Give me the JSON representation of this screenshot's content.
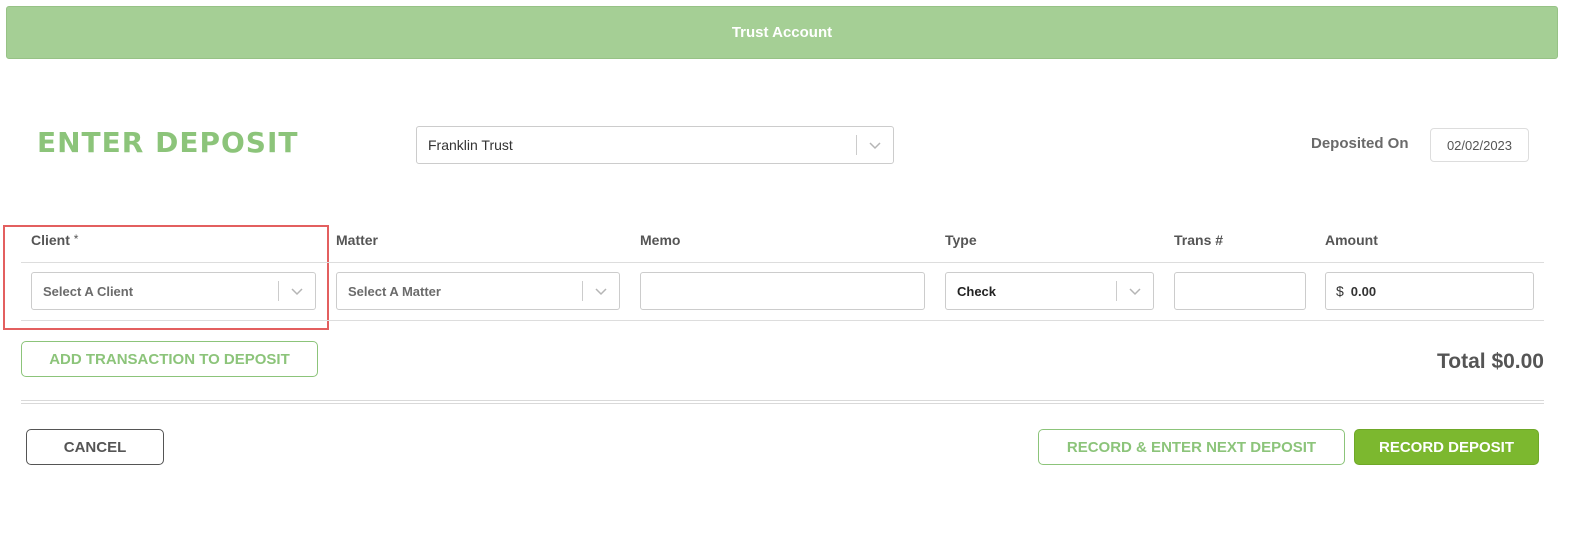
{
  "banner": {
    "title": "Trust Account"
  },
  "page": {
    "title": "ENTER DEPOSIT"
  },
  "account_select": {
    "value": "Franklin Trust"
  },
  "deposit_date": {
    "label": "Deposited On",
    "value": "02/02/2023"
  },
  "columns": {
    "client": "Client",
    "client_required": "*",
    "matter": "Matter",
    "memo": "Memo",
    "type": "Type",
    "trans": "Trans #",
    "amount": "Amount"
  },
  "row": {
    "client_placeholder": "Select A Client",
    "matter_placeholder": "Select A Matter",
    "memo_value": "",
    "type_value": "Check",
    "trans_value": "",
    "currency_symbol": "$",
    "amount_value": "0.00"
  },
  "buttons": {
    "add_transaction": "ADD TRANSACTION TO DEPOSIT",
    "cancel": "CANCEL",
    "record_next": "RECORD & ENTER NEXT DEPOSIT",
    "record": "RECORD DEPOSIT"
  },
  "total": {
    "text": "Total $0.00"
  },
  "icons": {
    "dropdown": "chevron-down-icon"
  },
  "colors": {
    "banner": "#a5cf95",
    "accent_green": "#8cc47a",
    "primary_button": "#7cb82f",
    "highlight_red": "#e35f5f"
  }
}
